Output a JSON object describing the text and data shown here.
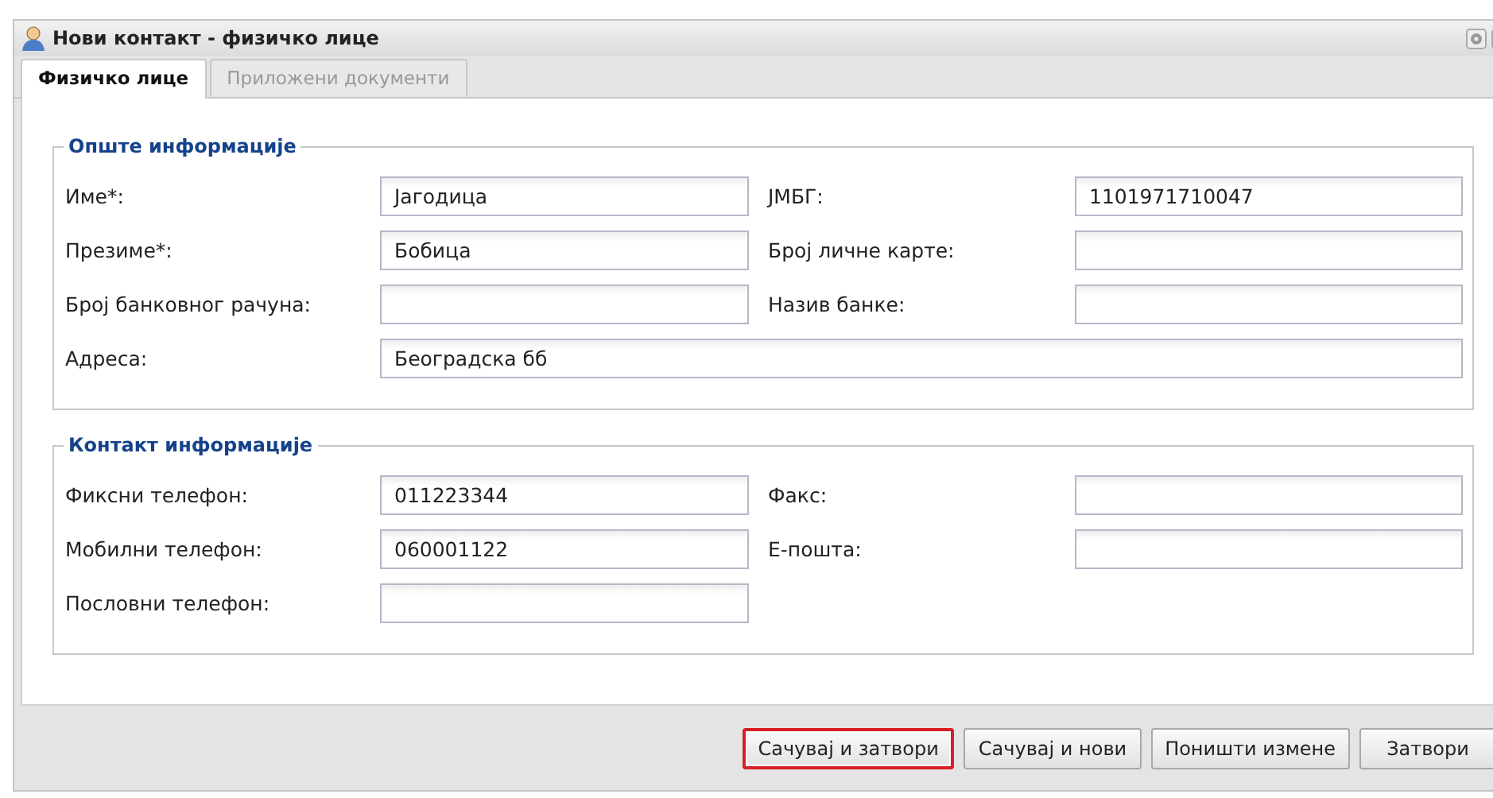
{
  "window": {
    "title": "Нови контакт - физичко лице"
  },
  "tabs": [
    {
      "label": "Физичко лице",
      "selected": true
    },
    {
      "label": "Приложени документи",
      "selected": false
    }
  ],
  "sections": [
    {
      "title": "Опште информације",
      "fields": [
        {
          "label": "Име*:",
          "value": "Јагодица",
          "kind": "half"
        },
        {
          "label": "ЈМБГ:",
          "value": "1101971710047",
          "kind": "half"
        },
        {
          "label": "Презиме*:",
          "value": "Бобица",
          "kind": "half"
        },
        {
          "label": "Број личне карте:",
          "kind": "half"
        },
        {
          "label": "Број банковног рачуна:",
          "kind": "half"
        },
        {
          "label": "Назив банке:",
          "kind": "half"
        },
        {
          "label": "Адреса:",
          "value": "Београдска бб",
          "kind": "wide"
        }
      ]
    },
    {
      "title": "Контакт информације",
      "fields": [
        {
          "label": "Фиксни телефон:",
          "value": "011223344",
          "kind": "half"
        },
        {
          "label": "Факс:",
          "kind": "half"
        },
        {
          "label": "Мобилни телефон:",
          "value": "060001122",
          "kind": "half"
        },
        {
          "label": "Е-пошта:",
          "kind": "half"
        },
        {
          "label": "Пословни телефон:",
          "kind": "half"
        }
      ]
    }
  ],
  "buttons": [
    {
      "label": "Сачувај и затвори",
      "highlighted": true
    },
    {
      "label": "Сачувај и нови",
      "highlighted": false
    },
    {
      "label": "Поништи измене",
      "highlighted": false
    },
    {
      "label": "Затвори",
      "highlighted": false
    }
  ]
}
